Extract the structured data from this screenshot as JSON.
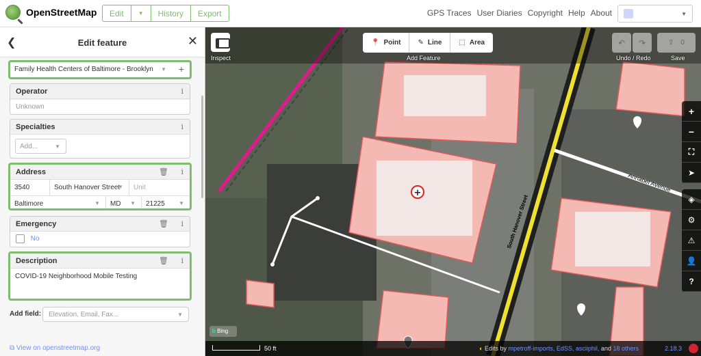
{
  "app": {
    "name": "OpenStreetMap",
    "nav": [
      "Edit",
      "History",
      "Export"
    ],
    "links": [
      "GPS Traces",
      "User Diaries",
      "Copyright",
      "Help",
      "About"
    ]
  },
  "sidebar": {
    "title": "Edit feature",
    "preset_value": "Family Health Centers of Baltimore - Brooklyn",
    "operator": {
      "label": "Operator",
      "placeholder": "Unknown"
    },
    "specialties": {
      "label": "Specialties",
      "placeholder": "Add..."
    },
    "address": {
      "label": "Address",
      "housenumber": "3540",
      "street": "South Hanover Street",
      "unit_placeholder": "Unit",
      "city": "Baltimore",
      "state": "MD",
      "postcode": "21225"
    },
    "emergency": {
      "label": "Emergency",
      "value": "No"
    },
    "description": {
      "label": "Description",
      "value": "COVID-19 Neighborhood Mobile Testing"
    },
    "add_field": {
      "label": "Add field:",
      "placeholder": "Elevation, Email, Fax..."
    },
    "view_link": "View on openstreetmap.org"
  },
  "map": {
    "inspect_label": "Inspect",
    "add_feature_label": "Add Feature",
    "tools": [
      "Point",
      "Line",
      "Area"
    ],
    "undo_redo_label": "Undo / Redo",
    "save_label": "Save",
    "save_count": "0",
    "street_labels": [
      "South Hanover Street",
      "Annabel Avenue"
    ],
    "bing_label": "Bing",
    "scale": "50 ft",
    "edits_prefix": "Edits by",
    "editors": "mpetroff-imports, EdSS, asciiphil,",
    "edits_mid": "and",
    "others": "18 others",
    "version": "2.18.3"
  },
  "colors": {
    "accent": "#7ebc6f",
    "link": "#7092ff",
    "primary_road": "#f0e030",
    "rail": "#e01c8c",
    "building": "#f0a0a0"
  }
}
